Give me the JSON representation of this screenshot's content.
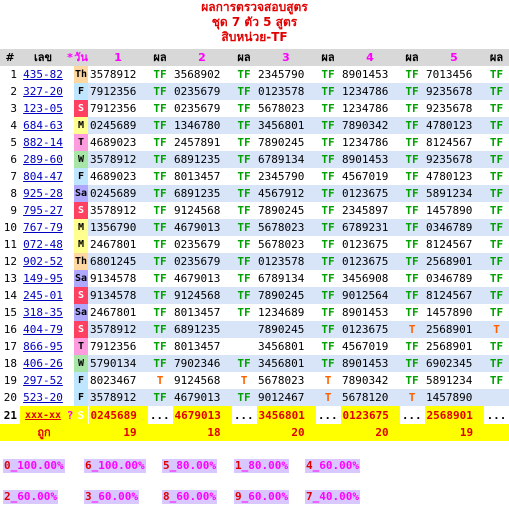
{
  "header": {
    "line1": "ผลการตรวจสอบสูตร",
    "line2": "ชุด 7 ตัว 5 สูตร",
    "line3": "สิบหน่วย-TF"
  },
  "columns": {
    "hash": "#",
    "lek": "เลข",
    "star": "*",
    "wan": "วัน",
    "c1": "1",
    "c2": "2",
    "c3": "3",
    "c4": "4",
    "c5": "5",
    "phon": "ผล"
  },
  "rows": [
    {
      "n": "1",
      "lek": "435-82",
      "day": "Th",
      "s": [
        "3578912",
        "3568902",
        "2345790",
        "8901453",
        "7013456"
      ],
      "r": [
        "TF",
        "TF",
        "TF",
        "TF",
        "TF"
      ]
    },
    {
      "n": "2",
      "lek": "327-20",
      "day": "F",
      "s": [
        "7912356",
        "0235679",
        "0123578",
        "1234786",
        "9235678"
      ],
      "r": [
        "TF",
        "TF",
        "TF",
        "TF",
        "TF"
      ]
    },
    {
      "n": "3",
      "lek": "123-05",
      "day": "S",
      "s": [
        "7912356",
        "0235679",
        "5678023",
        "1234786",
        "9235678"
      ],
      "r": [
        "TF",
        "TF",
        "TF",
        "TF",
        "TF"
      ]
    },
    {
      "n": "4",
      "lek": "684-63",
      "day": "M",
      "s": [
        "0245689",
        "1346780",
        "3456801",
        "7890342",
        "4780123"
      ],
      "r": [
        "TF",
        "TF",
        "TF",
        "TF",
        "TF"
      ]
    },
    {
      "n": "5",
      "lek": "882-14",
      "day": "T",
      "s": [
        "4689023",
        "2457891",
        "7890245",
        "1234786",
        "8124567"
      ],
      "r": [
        "TF",
        "TF",
        "TF",
        "TF",
        "TF"
      ]
    },
    {
      "n": "6",
      "lek": "289-60",
      "day": "W",
      "s": [
        "3578912",
        "6891235",
        "6789134",
        "8901453",
        "9235678"
      ],
      "r": [
        "TF",
        "TF",
        "TF",
        "TF",
        "TF"
      ]
    },
    {
      "n": "7",
      "lek": "804-47",
      "day": "F",
      "s": [
        "4689023",
        "8013457",
        "2345790",
        "4567019",
        "4780123"
      ],
      "r": [
        "TF",
        "TF",
        "TF",
        "TF",
        "TF"
      ]
    },
    {
      "n": "8",
      "lek": "925-28",
      "day": "Sa",
      "s": [
        "0245689",
        "6891235",
        "4567912",
        "0123675",
        "5891234"
      ],
      "r": [
        "TF",
        "TF",
        "TF",
        "TF",
        "TF"
      ]
    },
    {
      "n": "9",
      "lek": "795-27",
      "day": "S",
      "s": [
        "3578912",
        "9124568",
        "7890245",
        "2345897",
        "1457890"
      ],
      "r": [
        "TF",
        "TF",
        "TF",
        "TF",
        "TF"
      ]
    },
    {
      "n": "10",
      "lek": "767-79",
      "day": "M",
      "s": [
        "1356790",
        "4679013",
        "5678023",
        "6789231",
        "0346789"
      ],
      "r": [
        "TF",
        "TF",
        "TF",
        "TF",
        "TF"
      ]
    },
    {
      "n": "11",
      "lek": "072-48",
      "day": "M",
      "s": [
        "2467801",
        "0235679",
        "5678023",
        "0123675",
        "8124567"
      ],
      "r": [
        "TF",
        "TF",
        "TF",
        "TF",
        "TF"
      ]
    },
    {
      "n": "12",
      "lek": "902-52",
      "day": "Th",
      "s": [
        "6801245",
        "0235679",
        "0123578",
        "0123675",
        "2568901"
      ],
      "r": [
        "TF",
        "TF",
        "TF",
        "TF",
        "TF"
      ]
    },
    {
      "n": "13",
      "lek": "149-95",
      "day": "Sa",
      "s": [
        "9134578",
        "4679013",
        "6789134",
        "3456908",
        "0346789"
      ],
      "r": [
        "TF",
        "TF",
        "TF",
        "TF",
        "TF"
      ]
    },
    {
      "n": "14",
      "lek": "245-01",
      "day": "S",
      "s": [
        "9134578",
        "9124568",
        "7890245",
        "9012564",
        "8124567"
      ],
      "r": [
        "TF",
        "TF",
        "TF",
        "TF",
        "TF"
      ]
    },
    {
      "n": "15",
      "lek": "318-35",
      "day": "Sa",
      "s": [
        "2467801",
        "8013457",
        "1234689",
        "8901453",
        "1457890"
      ],
      "r": [
        "TF",
        "TF",
        "TF",
        "TF",
        "TF"
      ]
    },
    {
      "n": "16",
      "lek": "404-79",
      "day": "S",
      "s": [
        "3578912",
        "6891235",
        "7890245",
        "0123675",
        "2568901"
      ],
      "r": [
        "TF",
        "",
        "TF",
        "T",
        "T"
      ]
    },
    {
      "n": "17",
      "lek": "866-95",
      "day": "T",
      "s": [
        "7912356",
        "8013457",
        "3456801",
        "4567019",
        "2568901"
      ],
      "r": [
        "TF",
        "",
        "TF",
        "TF",
        "TF"
      ]
    },
    {
      "n": "18",
      "lek": "406-26",
      "day": "W",
      "s": [
        "5790134",
        "7902346",
        "3456801",
        "8901453",
        "6902345"
      ],
      "r": [
        "TF",
        "TF",
        "TF",
        "TF",
        "TF"
      ]
    },
    {
      "n": "19",
      "lek": "297-52",
      "day": "F",
      "s": [
        "8023467",
        "9124568",
        "5678023",
        "7890342",
        "5891234"
      ],
      "r": [
        "T",
        "T",
        "T",
        "TF",
        "TF"
      ]
    },
    {
      "n": "20",
      "lek": "523-20",
      "day": "F",
      "s": [
        "3578912",
        "4679013",
        "9012467",
        "5678120",
        "1457890"
      ],
      "r": [
        "TF",
        "TF",
        "T",
        "T",
        ""
      ]
    }
  ],
  "predict": {
    "n": "21",
    "lek": "xxx-xx",
    "q": "?",
    "day": "S",
    "s": [
      "0245689",
      "4679013",
      "3456801",
      "0123675",
      "2568901"
    ],
    "dots": "..."
  },
  "totals": {
    "label": "ถูก",
    "v": [
      "19",
      "18",
      "20",
      "20",
      "19"
    ]
  },
  "pcts": [
    {
      "d": "0",
      "p": "100.00%"
    },
    {
      "d": "6",
      "p": "100.00%"
    },
    {
      "d": "5",
      "p": "80.00%"
    },
    {
      "d": "1",
      "p": "80.00%"
    },
    {
      "d": "4",
      "p": "60.00%"
    },
    {
      "d": "2",
      "p": "60.00%"
    },
    {
      "d": "3",
      "p": "60.00%"
    },
    {
      "d": "8",
      "p": "60.00%"
    },
    {
      "d": "9",
      "p": "60.00%"
    },
    {
      "d": "7",
      "p": "40.00%"
    }
  ],
  "colors": {
    "header_text": "#e00000",
    "tf": "#00a000",
    "t": "#ff6000",
    "highlight": "#ffff00"
  }
}
